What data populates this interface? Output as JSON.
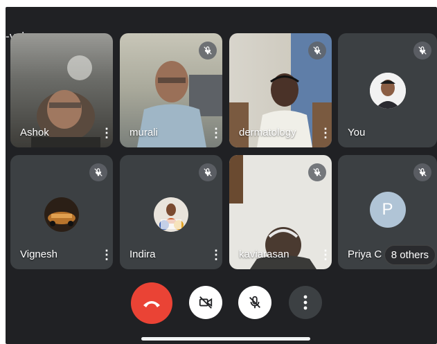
{
  "meeting": {
    "code": "-vvhr-puv"
  },
  "tiles": [
    {
      "name": "Ashok"
    },
    {
      "name": "murali"
    },
    {
      "name": "dermatology"
    },
    {
      "name": "You"
    },
    {
      "name": "Vignesh"
    },
    {
      "name": "Indira"
    },
    {
      "name": "kaviarasan"
    },
    {
      "name": "Priya C",
      "avatar_letter": "P"
    }
  ],
  "others": {
    "label": "8 others"
  },
  "controls": {
    "end_call_color": "#ea4335",
    "icons": [
      "end-call-icon",
      "camera-off-icon",
      "mic-off-icon",
      "more-vert-icon"
    ]
  }
}
